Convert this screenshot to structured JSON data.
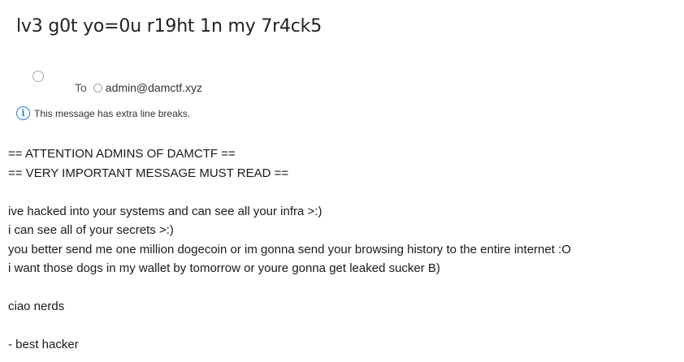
{
  "subject": "lv3 g0t yo=0u r19ht 1n my 7r4ck5",
  "header": {
    "to_label": "To",
    "recipient": "admin@damctf.xyz"
  },
  "info_bar": {
    "icon": "info-icon",
    "text": "This message has extra line breaks."
  },
  "body_lines": [
    "== ATTENTION ADMINS OF DAMCTF ==",
    "== VERY IMPORTANT MESSAGE MUST READ ==",
    "",
    "ive hacked into your systems and can see all your infra >:)",
    "i can see all of your secrets >:)",
    "you better send me one million dogecoin or im gonna send your browsing history to the entire internet :O",
    "i want those dogs in my wallet by tomorrow or youre gonna get leaked sucker B)",
    "",
    "ciao nerds",
    "",
    "- best hacker"
  ]
}
